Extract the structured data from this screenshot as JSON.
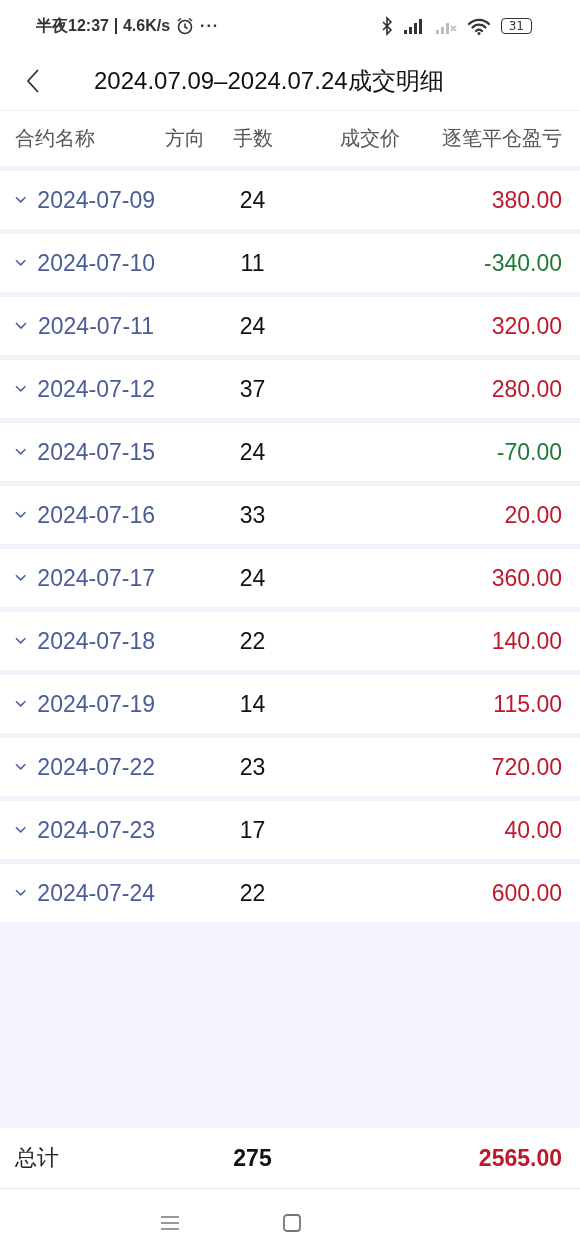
{
  "status_bar": {
    "time": "半夜12:37",
    "net_speed": "4.6K/s",
    "more": "···",
    "battery": "31"
  },
  "header": {
    "title": "2024.07.09–2024.07.24成交明细"
  },
  "table": {
    "columns": [
      "合约名称",
      "方向",
      "手数",
      "成交价",
      "逐笔平仓盈亏"
    ],
    "rows": [
      {
        "name": "2024-07-09",
        "lots": "24",
        "pnl": "380.00",
        "color": "#c0182b"
      },
      {
        "name": "2024-07-10",
        "lots": "11",
        "pnl": "-340.00",
        "color": "#1e7a35"
      },
      {
        "name": "2024-07-11",
        "lots": "24",
        "pnl": "320.00",
        "color": "#c0182b"
      },
      {
        "name": "2024-07-12",
        "lots": "37",
        "pnl": "280.00",
        "color": "#c0182b"
      },
      {
        "name": "2024-07-15",
        "lots": "24",
        "pnl": "-70.00",
        "color": "#1e7a35"
      },
      {
        "name": "2024-07-16",
        "lots": "33",
        "pnl": "20.00",
        "color": "#c0182b"
      },
      {
        "name": "2024-07-17",
        "lots": "24",
        "pnl": "360.00",
        "color": "#c0182b"
      },
      {
        "name": "2024-07-18",
        "lots": "22",
        "pnl": "140.00",
        "color": "#c0182b"
      },
      {
        "name": "2024-07-19",
        "lots": "14",
        "pnl": "115.00",
        "color": "#c0182b"
      },
      {
        "name": "2024-07-22",
        "lots": "23",
        "pnl": "720.00",
        "color": "#c0182b"
      },
      {
        "name": "2024-07-23",
        "lots": "17",
        "pnl": "40.00",
        "color": "#c0182b"
      },
      {
        "name": "2024-07-24",
        "lots": "22",
        "pnl": "600.00",
        "color": "#c0182b"
      }
    ]
  },
  "footer": {
    "label": "总计",
    "lots": "275",
    "pnl": "2565.00",
    "color": "#c0182b"
  }
}
